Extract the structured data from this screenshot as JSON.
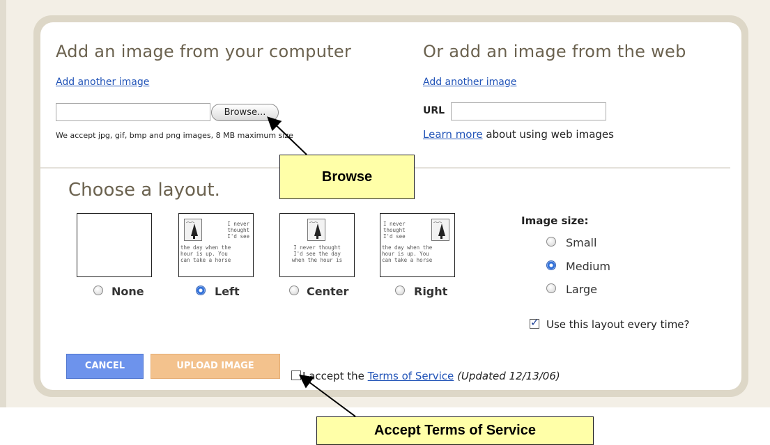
{
  "upload_computer": {
    "heading": "Add an image from your computer",
    "add_another": "Add another image",
    "file_value": "",
    "browse_label": "Browse...",
    "note": "We accept jpg, gif, bmp and png images, 8 MB maximum size"
  },
  "upload_web": {
    "heading": "Or add an image from the web",
    "add_another": "Add another image",
    "url_label": "URL",
    "url_value": "",
    "learn_more_link": "Learn more",
    "learn_more_rest": " about using web images"
  },
  "layout": {
    "heading": "Choose a layout.",
    "sample_text_left": "I never\nthought\nI'd see",
    "sample_text_full": "the day when the\nhour is up. You\ncan take a horse",
    "sample_text_center": "I never thought\nI'd see the day\nwhen the hour is",
    "options": [
      {
        "label": "None",
        "selected": false
      },
      {
        "label": "Left",
        "selected": true
      },
      {
        "label": "Center",
        "selected": false
      },
      {
        "label": "Right",
        "selected": false
      }
    ]
  },
  "image_size": {
    "heading": "Image size:",
    "options": [
      {
        "label": "Small",
        "selected": false
      },
      {
        "label": "Medium",
        "selected": true
      },
      {
        "label": "Large",
        "selected": false
      }
    ]
  },
  "use_layout": {
    "label": "Use this layout every time?",
    "checked": true
  },
  "buttons": {
    "cancel": "CANCEL",
    "upload": "UPLOAD IMAGE"
  },
  "terms": {
    "checked": false,
    "prefix": "I accept the ",
    "link": "Terms of Service",
    "updated": "(Updated 12/13/06)"
  },
  "callouts": {
    "browse": "Browse",
    "accept_terms": "Accept Terms of Service"
  },
  "colors": {
    "link": "#2254b8",
    "cancel_button": "#6d93ec",
    "upload_button": "#f3c28d",
    "callout": "#ffffa8"
  }
}
